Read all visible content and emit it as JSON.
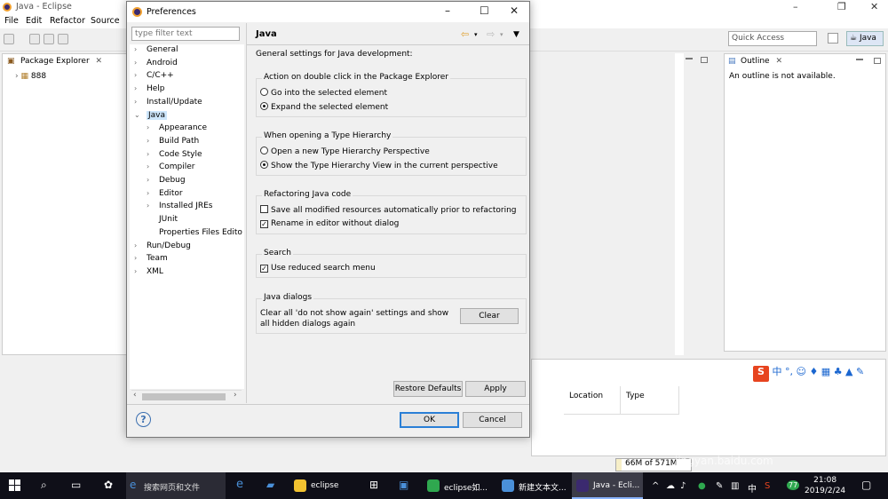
{
  "eclipse": {
    "title": "Java - Eclipse",
    "menu": [
      "File",
      "Edit",
      "Refactor",
      "Source"
    ],
    "quick_access": "Quick Access",
    "perspective": "Java",
    "package_explorer": {
      "tab": "Package Explorer",
      "project": "888"
    },
    "outline": {
      "tab": "Outline",
      "message": "An outline is not available."
    },
    "table_headers": {
      "location": "Location",
      "type": "Type"
    },
    "heap": "66M of 571M"
  },
  "dialog": {
    "title": "Preferences",
    "filter_placeholder": "type filter text",
    "tree": [
      {
        "label": "General",
        "level": 0,
        "arrow": ">"
      },
      {
        "label": "Android",
        "level": 0,
        "arrow": ">"
      },
      {
        "label": "C/C++",
        "level": 0,
        "arrow": ">"
      },
      {
        "label": "Help",
        "level": 0,
        "arrow": ">"
      },
      {
        "label": "Install/Update",
        "level": 0,
        "arrow": ">"
      },
      {
        "label": "Java",
        "level": 0,
        "arrow": "v",
        "selected": true
      },
      {
        "label": "Appearance",
        "level": 1,
        "arrow": ">"
      },
      {
        "label": "Build Path",
        "level": 1,
        "arrow": ">"
      },
      {
        "label": "Code Style",
        "level": 1,
        "arrow": ">"
      },
      {
        "label": "Compiler",
        "level": 1,
        "arrow": ">"
      },
      {
        "label": "Debug",
        "level": 1,
        "arrow": ">"
      },
      {
        "label": "Editor",
        "level": 1,
        "arrow": ">"
      },
      {
        "label": "Installed JREs",
        "level": 1,
        "arrow": ">"
      },
      {
        "label": "JUnit",
        "level": 1,
        "arrow": ""
      },
      {
        "label": "Properties Files Edito",
        "level": 1,
        "arrow": ""
      },
      {
        "label": "Run/Debug",
        "level": 0,
        "arrow": ">"
      },
      {
        "label": "Team",
        "level": 0,
        "arrow": ">"
      },
      {
        "label": "XML",
        "level": 0,
        "arrow": ">"
      }
    ],
    "page_title": "Java",
    "description": "General settings for Java development:",
    "groups": {
      "double_click": {
        "title": "Action on double click in the Package Explorer",
        "go_into": "Go into the selected element",
        "expand": "Expand the selected element"
      },
      "type_hierarchy": {
        "title": "When opening a Type Hierarchy",
        "new_perspective": "Open a new Type Hierarchy Perspective",
        "show_view": "Show the Type Hierarchy View in the current perspective"
      },
      "refactoring": {
        "title": "Refactoring Java code",
        "save_all": "Save all modified resources automatically prior to refactoring",
        "rename_in_editor": "Rename in editor without dialog"
      },
      "search": {
        "title": "Search",
        "reduced_menu": "Use reduced search menu"
      },
      "java_dialogs": {
        "title": "Java dialogs",
        "text": "Clear all 'do not show again' settings and show all hidden dialogs again",
        "clear_button": "Clear"
      }
    },
    "restore_defaults": "Restore Defaults",
    "apply": "Apply",
    "ok": "OK",
    "cancel": "Cancel",
    "help_glyph": "?"
  },
  "taskbar": {
    "search_text": "搜索网页和文件",
    "apps": [
      {
        "label": "eclipse",
        "color": "#f2c230"
      },
      {
        "label": "eclipse如...",
        "color": "#2fa84f"
      },
      {
        "label": "新建文本文...",
        "color": "#4a90d9"
      },
      {
        "label": "Java - Ecli...",
        "color": "#3b2a6f"
      }
    ],
    "tray_lang": "中",
    "tray_badge": "77",
    "time": "21:08",
    "date": "2019/2/24"
  },
  "watermark": {
    "logo": "Baidu经验",
    "url": "jingyan.baidu.com"
  }
}
